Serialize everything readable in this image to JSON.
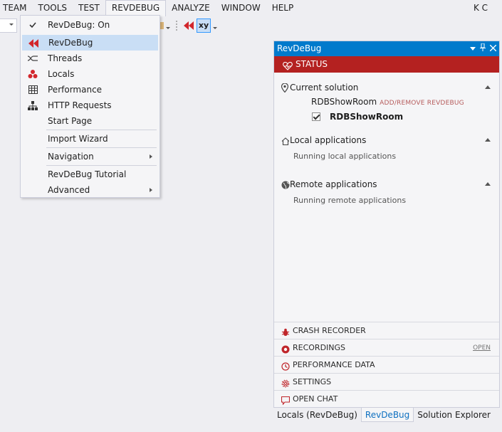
{
  "menubar": {
    "items": [
      "TEAM",
      "TOOLS",
      "TEST",
      "REVDEBUG",
      "ANALYZE",
      "WINDOW",
      "HELP"
    ],
    "open_item": "REVDEBUG",
    "user": "K C"
  },
  "toolbar": {
    "xy_label": "xy"
  },
  "revdebug_menu": {
    "items": [
      {
        "label": "RevDeBug: On",
        "icon": "check-icon"
      },
      {
        "label": "RevDeBug",
        "icon": "revdebug-rewind-icon"
      },
      {
        "label": "Threads",
        "icon": "threads-icon"
      },
      {
        "label": "Locals",
        "icon": "locals-icon"
      },
      {
        "label": "Performance",
        "icon": "table-grid-icon"
      },
      {
        "label": "HTTP Requests",
        "icon": "hierarchy-icon"
      },
      {
        "label": "Start Page"
      },
      {
        "label": "Import Wizard"
      },
      {
        "label": "Navigation",
        "submenu": true
      },
      {
        "label": "RevDeBug Tutorial"
      },
      {
        "label": "Advanced",
        "submenu": true
      }
    ],
    "highlighted": "RevDeBug"
  },
  "panel": {
    "title": "RevDeBug",
    "status_label": "STATUS",
    "current_solution": {
      "heading": "Current solution",
      "solution_name": "RDBShowRoom",
      "link": "ADD/REMOVE REVDEBUG",
      "project": "RDBShowRoom",
      "project_checked": true
    },
    "local_apps": {
      "heading": "Local applications",
      "text": "Running local applications"
    },
    "remote_apps": {
      "heading": "Remote applications",
      "text": "Running remote applications"
    },
    "nav": [
      {
        "label": "CRASH RECORDER",
        "icon": "bug-icon"
      },
      {
        "label": "RECORDINGS",
        "icon": "record-icon",
        "link": "OPEN"
      },
      {
        "label": "PERFORMANCE DATA",
        "icon": "clock-icon"
      },
      {
        "label": "SETTINGS",
        "icon": "gear-icon"
      },
      {
        "label": "OPEN CHAT",
        "icon": "chat-icon"
      }
    ]
  },
  "bottom_tabs": [
    "Locals (RevDeBug)",
    "RevDeBug",
    "Solution Explorer"
  ],
  "active_tab": "RevDeBug",
  "colors": {
    "accent_blue": "#007acc",
    "status_red": "#b42120",
    "menu_highlight": "#c9def5",
    "revdebug_red": "#d2262c"
  }
}
